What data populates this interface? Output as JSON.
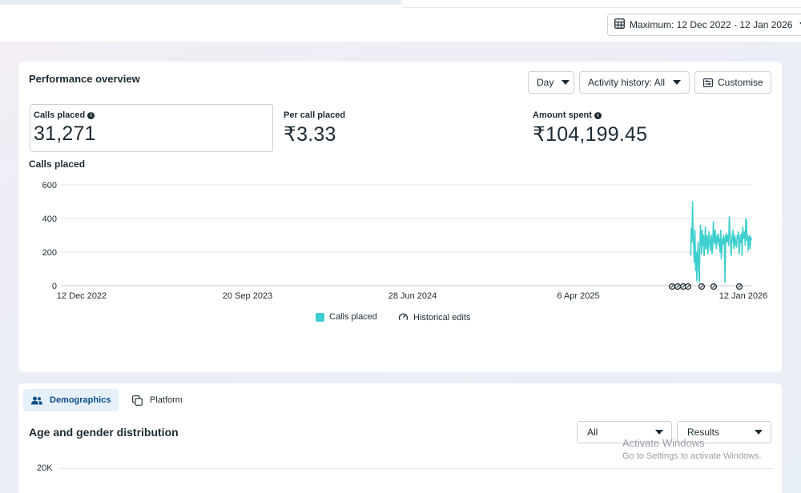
{
  "header": {
    "date_range_label": "Maximum: 12 Dec 2022 - 12 Jan 2026"
  },
  "performance": {
    "title": "Performance overview",
    "granularity": "Day",
    "activity_filter": "Activity history: All",
    "customise_label": "Customise",
    "metrics": [
      {
        "label": "Calls placed",
        "value": "31,271",
        "has_info": true
      },
      {
        "label": "Per call placed",
        "value": "₹3.33",
        "has_info": false
      },
      {
        "label": "Amount spent",
        "value": "₹104,199.45",
        "has_info": true
      }
    ]
  },
  "chart": {
    "title": "Calls placed",
    "y_ticks": [
      "600",
      "400",
      "200",
      "0"
    ],
    "x_ticks": [
      "12 Dec 2022",
      "20 Sep 2023",
      "28 Jun 2024",
      "6 Apr 2025",
      "12 Jan 2026"
    ],
    "legend": {
      "series": "Calls placed",
      "edits": "Historical edits"
    }
  },
  "chart_data": {
    "type": "line",
    "title": "Calls placed",
    "xlabel": "",
    "ylabel": "",
    "ylim": [
      0,
      600
    ],
    "xlim": [
      "2022-12-12",
      "2026-01-12"
    ],
    "grid": true,
    "legend_position": "bottom",
    "x": [
      "2025-10-05",
      "2025-10-06",
      "2025-10-07",
      "2025-10-08",
      "2025-10-09",
      "2025-10-10",
      "2025-10-11",
      "2025-10-12",
      "2025-10-13",
      "2025-10-14",
      "2025-10-15",
      "2025-10-16",
      "2025-10-17",
      "2025-10-18",
      "2025-10-19",
      "2025-10-20",
      "2025-10-21",
      "2025-10-22",
      "2025-10-23",
      "2025-10-24",
      "2025-10-25",
      "2025-10-26",
      "2025-10-27",
      "2025-10-28",
      "2025-10-29",
      "2025-10-30",
      "2025-10-31",
      "2025-11-01",
      "2025-11-02",
      "2025-11-03",
      "2025-11-04",
      "2025-11-05",
      "2025-11-06",
      "2025-11-07",
      "2025-11-08",
      "2025-11-09",
      "2025-11-10",
      "2025-11-11",
      "2025-11-12",
      "2025-11-13",
      "2025-11-14",
      "2025-11-15",
      "2025-11-16",
      "2025-11-17",
      "2025-11-18",
      "2025-11-19",
      "2025-11-20",
      "2025-11-21",
      "2025-11-22",
      "2025-11-23",
      "2025-11-24",
      "2025-11-25",
      "2025-11-26",
      "2025-11-27",
      "2025-11-28",
      "2025-11-29",
      "2025-11-30",
      "2025-12-01",
      "2025-12-02",
      "2025-12-03",
      "2025-12-04",
      "2025-12-05",
      "2025-12-06",
      "2025-12-07",
      "2025-12-08",
      "2025-12-09",
      "2025-12-10",
      "2025-12-11",
      "2025-12-12",
      "2025-12-13",
      "2025-12-14",
      "2025-12-15",
      "2025-12-16",
      "2025-12-17",
      "2025-12-18",
      "2025-12-19",
      "2025-12-20",
      "2025-12-21",
      "2025-12-22",
      "2025-12-23",
      "2025-12-24",
      "2025-12-25",
      "2025-12-26",
      "2025-12-27",
      "2025-12-28",
      "2025-12-29",
      "2025-12-30",
      "2025-12-31",
      "2026-01-01",
      "2026-01-02",
      "2026-01-03",
      "2026-01-04",
      "2026-01-05",
      "2026-01-06",
      "2026-01-07",
      "2026-01-08",
      "2026-01-09",
      "2026-01-10",
      "2026-01-11",
      "2026-01-12"
    ],
    "series": [
      {
        "name": "Calls placed",
        "color": "#3ccfce",
        "values": [
          180,
          340,
          260,
          500,
          310,
          230,
          140,
          330,
          90,
          200,
          30,
          160,
          260,
          120,
          20,
          230,
          360,
          280,
          190,
          330,
          240,
          300,
          180,
          260,
          350,
          220,
          270,
          300,
          190,
          250,
          320,
          280,
          210,
          260,
          300,
          190,
          230,
          380,
          290,
          250,
          330,
          270,
          220,
          300,
          260,
          310,
          240,
          280,
          200,
          330,
          160,
          220,
          280,
          250,
          300,
          270,
          20,
          290,
          310,
          260,
          300,
          280,
          240,
          410,
          320,
          270,
          180,
          260,
          300,
          330,
          250,
          220,
          300,
          270,
          240,
          230,
          300,
          280,
          320,
          190,
          240,
          300,
          260,
          310,
          180,
          350,
          300,
          280,
          320,
          240,
          400,
          380,
          270,
          300,
          210,
          260,
          300,
          220,
          290,
          270
        ]
      }
    ]
  },
  "tabs": [
    {
      "label": "Demographics",
      "active": true
    },
    {
      "label": "Platform",
      "active": false
    }
  ],
  "demographics": {
    "title": "Age and gender distribution",
    "filter_value": "All",
    "metric_value": "Results",
    "y_tick_top": "20K"
  },
  "watermark": {
    "line1": "Activate Windows",
    "line2": "Go to Settings to activate Windows."
  }
}
